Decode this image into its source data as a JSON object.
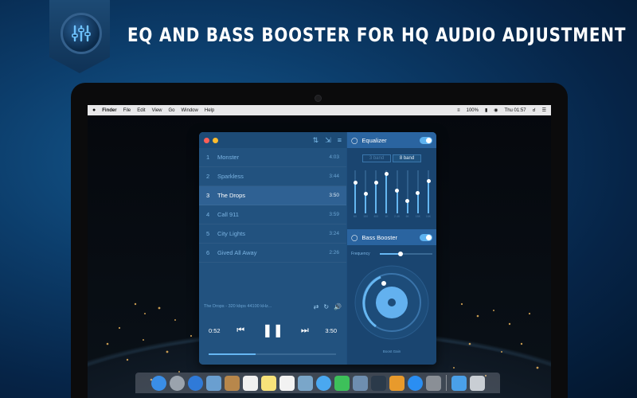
{
  "headline": "EQ AND BASS BOOSTER FOR HQ AUDIO ADJUSTMENT",
  "menubar": {
    "apple": "",
    "app": "Finder",
    "items": [
      "File",
      "Edit",
      "View",
      "Go",
      "Window",
      "Help"
    ],
    "battery": "100%",
    "clock": "Thu 01:57"
  },
  "player": {
    "tracks": [
      {
        "num": "1",
        "title": "Monster",
        "dur": "4:03"
      },
      {
        "num": "2",
        "title": "Sparkless",
        "dur": "3:44"
      },
      {
        "num": "3",
        "title": "The Drops",
        "dur": "3:50"
      },
      {
        "num": "4",
        "title": "Call 911",
        "dur": "3:59"
      },
      {
        "num": "5",
        "title": "City Lights",
        "dur": "3:24"
      },
      {
        "num": "6",
        "title": "Gived All Away",
        "dur": "2:26"
      }
    ],
    "active_index": 2,
    "now_playing_info": "The Drops - 320 kbps 44100 kHz...",
    "elapsed": "0:52",
    "total": "3:50",
    "progress": 0.37,
    "colors": {
      "close": "#ff5f57",
      "minimize": "#febc2e",
      "accent": "#66b7f2"
    }
  },
  "equalizer": {
    "title": "Equalizer",
    "enabled": true,
    "tabs": [
      "3 band",
      "8 band"
    ],
    "active_tab": 1,
    "bands": [
      {
        "label": "60",
        "level": 0.72
      },
      {
        "label": "150",
        "level": 0.45
      },
      {
        "label": "400",
        "level": 0.72
      },
      {
        "label": "1K",
        "level": 0.92
      },
      {
        "label": "2.4K",
        "level": 0.52
      },
      {
        "label": "6K",
        "level": 0.28
      },
      {
        "label": "15K",
        "level": 0.48
      },
      {
        "label": "16K",
        "level": 0.75
      }
    ]
  },
  "bass_booster": {
    "title": "Bass Booster",
    "enabled": true,
    "frequency_label": "Frequency",
    "frequency": 0.4,
    "gain_label": "Boost Gain"
  },
  "dock": {
    "icons": [
      "finder-icon",
      "launchpad-icon",
      "safari-icon",
      "photo-icon",
      "contacts-icon",
      "calendar-icon",
      "notes-icon",
      "reminders-icon",
      "preview-icon",
      "messages-icon",
      "facetime-icon",
      "photos-icon",
      "quicktime-icon",
      "ibooks-icon",
      "app-store-icon",
      "system-preferences-icon",
      "downloads-icon",
      "trash-icon"
    ]
  }
}
